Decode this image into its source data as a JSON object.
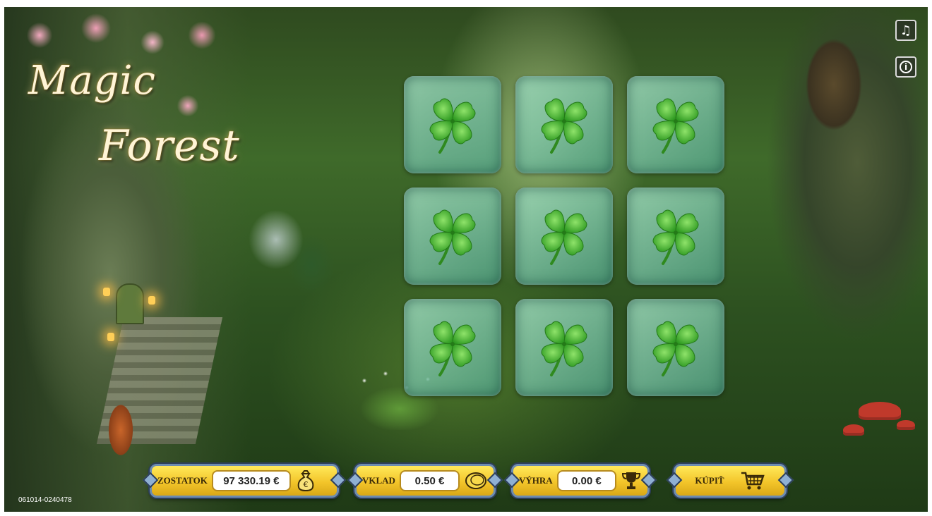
{
  "title": {
    "line1": "Magic",
    "line2": "Forest"
  },
  "controls": {
    "music_icon": "♫",
    "info_icon": "i"
  },
  "tiles": [
    {
      "symbol": "four-leaf-clover"
    },
    {
      "symbol": "four-leaf-clover"
    },
    {
      "symbol": "four-leaf-clover"
    },
    {
      "symbol": "four-leaf-clover"
    },
    {
      "symbol": "four-leaf-clover"
    },
    {
      "symbol": "four-leaf-clover"
    },
    {
      "symbol": "four-leaf-clover"
    },
    {
      "symbol": "four-leaf-clover"
    },
    {
      "symbol": "four-leaf-clover"
    }
  ],
  "bottom_bar": {
    "balance": {
      "label": "ZOSTATOK",
      "value": "97 330.19 €",
      "icon": "money-bag-icon"
    },
    "bet": {
      "label": "VKLAD",
      "value": "0.50 €",
      "icon": "coin-icon"
    },
    "win": {
      "label": "VÝHRA",
      "value": "0.00 €",
      "icon": "trophy-icon"
    },
    "buy": {
      "label": "KÚPIŤ",
      "icon": "cart-icon"
    }
  },
  "ticket_id": "061014-0240478",
  "colors": {
    "accent_gold": "#f3c52a",
    "tile_teal": "#50a082",
    "clover_green": "#3fae2a",
    "frame_blue": "#6c8bb0"
  }
}
